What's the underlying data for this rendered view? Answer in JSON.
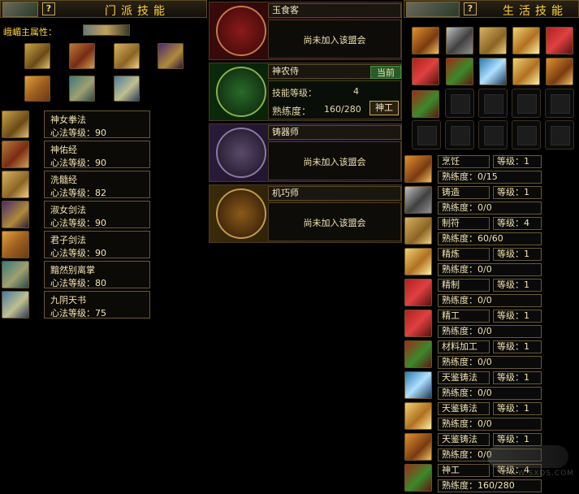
{
  "sect": {
    "title": "门派技能",
    "attr_label": "峨嵋主属性："
  },
  "sect_skills": [
    {
      "name": "神女拳法",
      "level": "心法等级：90"
    },
    {
      "name": "神佑经",
      "level": "心法等级：90"
    },
    {
      "name": "洗髓经",
      "level": "心法等级：82"
    },
    {
      "name": "淑女剑法",
      "level": "心法等级：90"
    },
    {
      "name": "君子剑法",
      "level": "心法等级：90"
    },
    {
      "name": "黯然别离掌",
      "level": "心法等级：80"
    },
    {
      "name": "九阴天书",
      "level": "心法等级：75"
    }
  ],
  "professions": [
    {
      "name": "玉食客",
      "status": "尚未加入该盟会"
    },
    {
      "name": "神农侍",
      "badge": "当前",
      "skill_label": "技能等级：",
      "skill_value": "4",
      "prof_label": "熟练度：",
      "prof_value": "160/280",
      "button": "神工"
    },
    {
      "name": "铸器师",
      "status": "尚未加入该盟会"
    },
    {
      "name": "机巧师",
      "status": "尚未加入该盟会"
    }
  ],
  "life": {
    "title": "生活技能"
  },
  "life_skills": [
    {
      "name": "烹饪",
      "level": "等级：1",
      "prof": "熟练度：0/15"
    },
    {
      "name": "铸造",
      "level": "等级：1",
      "prof": "熟练度：0/0"
    },
    {
      "name": "制符",
      "level": "等级：4",
      "prof": "熟练度：60/60"
    },
    {
      "name": "精炼",
      "level": "等级：1",
      "prof": "熟练度：0/0"
    },
    {
      "name": "精制",
      "level": "等级：1",
      "prof": "熟练度：0/0"
    },
    {
      "name": "精工",
      "level": "等级：1",
      "prof": "熟练度：0/0"
    },
    {
      "name": "材料加工",
      "level": "等级：1",
      "prof": "熟练度：0/0"
    },
    {
      "name": "天鉴铸法",
      "level": "等级：1",
      "prof": "熟练度：0/0"
    },
    {
      "name": "天鉴铸法",
      "level": "等级：1",
      "prof": "熟练度：0/0"
    },
    {
      "name": "天鉴铸法",
      "level": "等级：1",
      "prof": "熟练度：0/0"
    },
    {
      "name": "神工",
      "level": "等级：4",
      "prof": "熟练度：160/280"
    }
  ],
  "watermark": {
    "text": "WWW.SXDS.COM"
  },
  "colors": {
    "gold_title": "#ffd23a",
    "text": "#f0e2b0",
    "border": "#6a5a30"
  }
}
